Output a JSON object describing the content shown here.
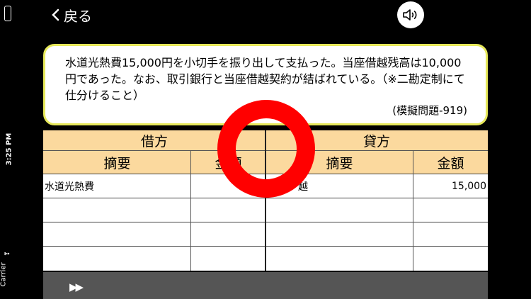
{
  "status": {
    "time": "3:25 PM",
    "carrier": "Carrier"
  },
  "header": {
    "back_label": "戻る"
  },
  "question": {
    "text": "水道光熱費15,000円を小切手を振り出して支払った。当座借越残高は10,000円であった。なお、取引銀行と当座借越契約が結ばれている。（※二勘定制にて仕分けること）",
    "id": "(模擬問題-919)"
  },
  "journal": {
    "debit_header": "借方",
    "credit_header": "貸方",
    "debit_name_header": "摘要",
    "debit_amount_header": "金額",
    "credit_name_header": "摘要",
    "credit_amount_header": "金額",
    "rows": [
      {
        "debit_name": "水道光熱費",
        "debit_amount": "",
        "credit_name": "越",
        "credit_amount": "15,000"
      },
      {
        "debit_name": "",
        "debit_amount": "",
        "credit_name": "",
        "credit_amount": ""
      },
      {
        "debit_name": "",
        "debit_amount": "",
        "credit_name": "",
        "credit_amount": ""
      },
      {
        "debit_name": "",
        "debit_amount": "",
        "credit_name": "",
        "credit_amount": ""
      }
    ]
  },
  "footer": {
    "next_label": "▶▶"
  },
  "feedback": {
    "mark": "correct-circle",
    "color": "#ff0000"
  }
}
